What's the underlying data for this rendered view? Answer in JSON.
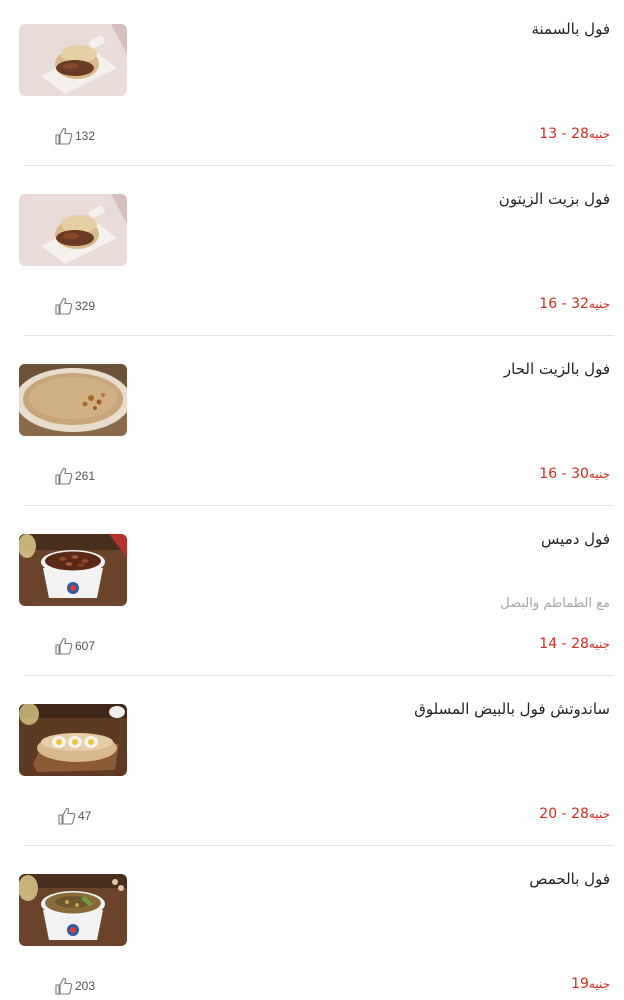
{
  "items": [
    {
      "title": "فول بالسمنة",
      "description": "",
      "price_min": "13",
      "price_max": "28",
      "price_separator": "-",
      "currency": "جنيه",
      "likes": "132",
      "image": "food-fava-sandwich-image"
    },
    {
      "title": "فول بزيت الزيتون",
      "description": "",
      "price_min": "16",
      "price_max": "32",
      "price_separator": "-",
      "currency": "جنيه",
      "likes": "329",
      "image": "food-fava-sandwich-image"
    },
    {
      "title": "فول بالزيت الحار",
      "description": "",
      "price_min": "16",
      "price_max": "30",
      "price_separator": "-",
      "currency": "جنيه",
      "likes": "261",
      "image": "food-soup-bowl-image"
    },
    {
      "title": "فول دميس",
      "description": "مع الطماطم والبصل",
      "price_min": "14",
      "price_max": "28",
      "price_separator": "-",
      "currency": "جنيه",
      "likes": "607",
      "image": "food-beans-cup-image"
    },
    {
      "title": "ساندوتش فول بالبيض المسلوق",
      "description": "",
      "price_min": "20",
      "price_max": "28",
      "price_separator": "-",
      "currency": "جنيه",
      "likes": "47",
      "image": "food-egg-sandwich-image"
    },
    {
      "title": "فول بالحمص",
      "description": "",
      "price_min": "19",
      "price_max": "",
      "price_separator": "",
      "currency": "جنيه",
      "likes": "203",
      "image": "food-hummus-cup-image"
    }
  ],
  "icons": {
    "like": "thumbs-up-icon"
  },
  "colors": {
    "price": "#d52b1e",
    "description": "#a6a6a6",
    "divider": "#e4e4e4"
  }
}
